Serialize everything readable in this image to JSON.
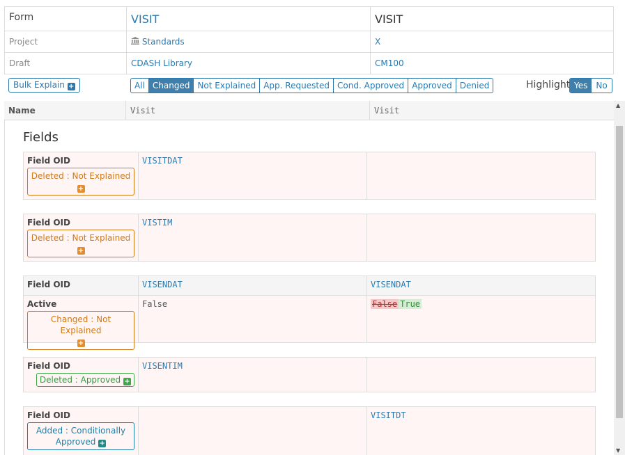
{
  "header": {
    "form_label": "Form",
    "form_left": "VISIT",
    "form_right": "VISIT",
    "project_label": "Project",
    "project_left": "Standards",
    "project_right": "X",
    "draft_label": "Draft",
    "draft_left": "CDASH Library",
    "draft_right": "CM100"
  },
  "toolbar": {
    "bulk_explain": "Bulk Explain",
    "filters": [
      "All",
      "Changed",
      "Not Explained",
      "App. Requested",
      "Cond. Approved",
      "Approved",
      "Denied"
    ],
    "active_filter": "Changed",
    "highlight_label": "Highlight",
    "highlight_yes": "Yes",
    "highlight_no": "No"
  },
  "columns": {
    "name": "Name",
    "left": "Visit",
    "right": "Visit"
  },
  "section_title": "Fields",
  "fields": [
    {
      "label": "Field OID",
      "status": "Deleted : Not Explained",
      "left": "VISITDAT",
      "right": ""
    },
    {
      "label": "Field OID",
      "status": "Deleted : Not Explained",
      "left": "VISTIM",
      "right": ""
    },
    {
      "label": "Field OID",
      "left": "VISENDAT",
      "right": "VISENDAT",
      "sub_label": "Active",
      "sub_status": "Changed : Not Explained",
      "sub_left": "False",
      "sub_right_old": "False",
      "sub_right_new": "True"
    },
    {
      "label": "Field OID",
      "status": "Deleted : Approved",
      "left": "VISENTIM",
      "right": ""
    },
    {
      "label": "Field OID",
      "status": "Added : Conditionally Approved",
      "left": "",
      "right": "VISITDT"
    }
  ],
  "icons": {
    "plus": "+",
    "bank": "bank-icon",
    "up": "▲",
    "down": "▼"
  }
}
